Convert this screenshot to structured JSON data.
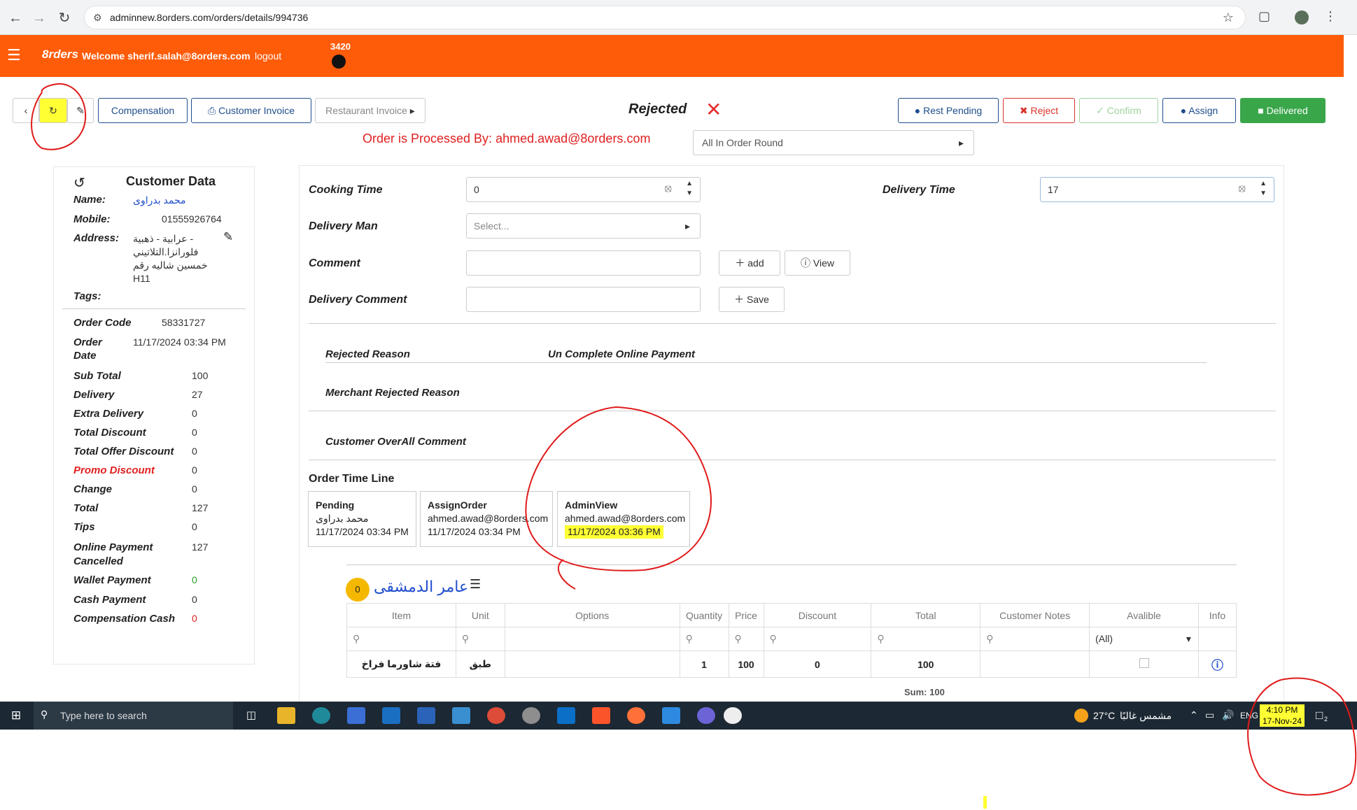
{
  "browser": {
    "url": "adminnew.8orders.com/orders/details/994736"
  },
  "header": {
    "logo": "8rders",
    "welcome": "Welcome sherif.salah@8orders.com",
    "logout": "logout",
    "count": "3420"
  },
  "toolbar": {
    "compensation": "Compensation",
    "customer_invoice": "Customer Invoice",
    "restaurant_invoice": "Restaurant Invoice",
    "status": "Rejected",
    "rest_pending": "Rest Pending",
    "reject": "Reject",
    "confirm": "Confirm",
    "assign": "Assign",
    "delivered": "Delivered",
    "processed_by": "Order is Processed By: ahmed.awad@8orders.com",
    "order_round": "All In Order Round"
  },
  "customer": {
    "title": "Customer Data",
    "name_label": "Name:",
    "name": "محمد بدراوى",
    "mobile_label": "Mobile:",
    "mobile": "01555926764",
    "address_label": "Address:",
    "address_l1": "عرابية - ذهبية -",
    "address_l2": "فلورانزا.التلاتيني",
    "address_l3": "خمسين شاليه رقم",
    "address_l4": "H11",
    "tags_label": "Tags:",
    "order_code_label": "Order Code",
    "order_code": "58331727",
    "order_date_label_1": "Order",
    "order_date_label_2": "Date",
    "order_date": "11/17/2024 03:34 PM",
    "sub_total_label": "Sub Total",
    "sub_total": "100",
    "delivery_label": "Delivery",
    "delivery": "27",
    "extra_delivery_label": "Extra Delivery",
    "extra_delivery": "0",
    "total_discount_label": "Total Discount",
    "total_discount": "0",
    "total_offer_discount_label": "Total Offer Discount",
    "total_offer_discount": "0",
    "promo_discount_label": "Promo Discount",
    "promo_discount": "0",
    "change_label": "Change",
    "change": "0",
    "total_label": "Total",
    "total": "127",
    "tips_label": "Tips",
    "tips": "0",
    "online_payment_label_1": "Online Payment",
    "online_payment_label_2": "Cancelled",
    "online_payment": "127",
    "wallet_payment_label": "Wallet Payment",
    "wallet_payment": "0",
    "cash_payment_label": "Cash Payment",
    "cash_payment": "0",
    "compensation_cash_label": "Compensation Cash",
    "compensation_cash": "0"
  },
  "form": {
    "cooking_time_label": "Cooking Time",
    "cooking_time": "0",
    "delivery_time_label": "Delivery Time",
    "delivery_time": "17",
    "delivery_man_label": "Delivery Man",
    "delivery_man_placeholder": "Select...",
    "comment_label": "Comment",
    "add": "add",
    "view": "View",
    "delivery_comment_label": "Delivery Comment",
    "save": "Save",
    "rejected_reason_label": "Rejected Reason",
    "rejected_reason": "Un Complete Online Payment",
    "merchant_rejected_reason_label": "Merchant Rejected Reason",
    "customer_comment_label": "Customer OverAll Comment"
  },
  "timeline": {
    "title": "Order Time Line",
    "entries": [
      {
        "status": "Pending",
        "by": "محمد بدراوى",
        "time": "11/17/2024 03:34 PM"
      },
      {
        "status": "AssignOrder",
        "by": "ahmed.awad@8orders.com",
        "time": "11/17/2024 03:34 PM"
      },
      {
        "status": "AdminView",
        "by": "ahmed.awad@8orders.com",
        "time": "11/17/2024 03:36 PM"
      }
    ]
  },
  "restaurant": {
    "badge": "0",
    "name": "عامر الدمشقى"
  },
  "items_table": {
    "columns": [
      "Item",
      "Unit",
      "Options",
      "Quantity",
      "Price",
      "Discount",
      "Total",
      "Customer Notes",
      "Avalible",
      "Info"
    ],
    "filter_all": "(All)",
    "rows": [
      {
        "item": "فتة شاورما فراخ",
        "unit": "طبق",
        "options": "",
        "quantity": "1",
        "price": "100",
        "discount": "0",
        "total": "100",
        "notes": ""
      }
    ],
    "sum": "Sum: 100"
  },
  "taskbar": {
    "search_placeholder": "Type here to search",
    "weather": "27°C",
    "weather_text": "مشمس غالبًا",
    "lang": "ENG",
    "time": "4:10 PM",
    "date": "17-Nov-24",
    "notifications": "2"
  },
  "colors": {
    "header": "#ff5c0a",
    "primary": "#1f4e8c",
    "reject": "#d9342b",
    "delivered": "#3aa64a",
    "annotation": "#e01b1b",
    "highlight": "#ffff33"
  }
}
